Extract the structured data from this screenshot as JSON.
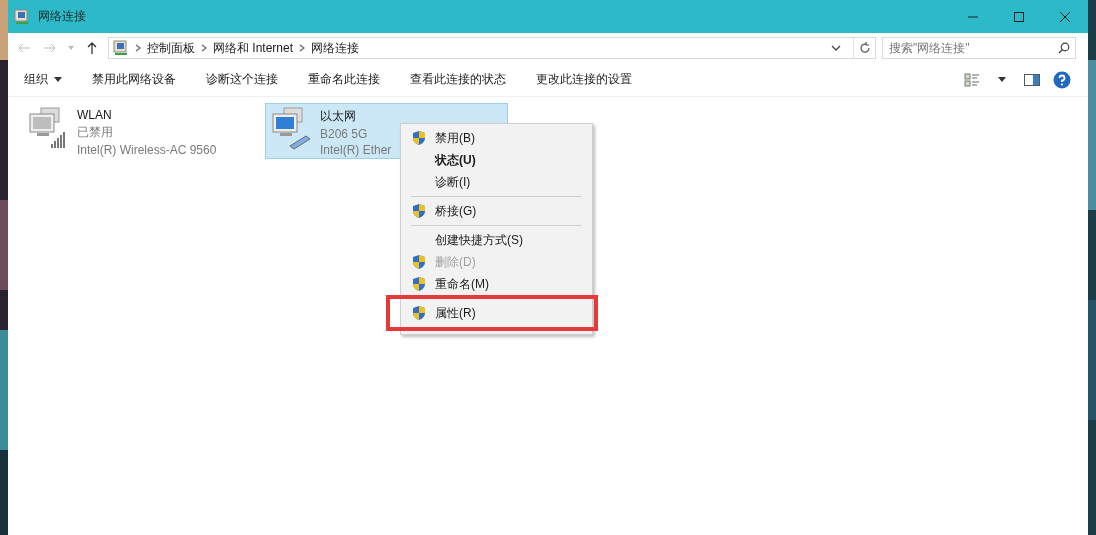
{
  "window": {
    "title": "网络连接"
  },
  "address": {
    "crumbs": [
      "控制面板",
      "网络和 Internet",
      "网络连接"
    ]
  },
  "search": {
    "placeholder": "搜索\"网络连接\""
  },
  "commands": [
    {
      "label": "组织",
      "dropdown": true
    },
    {
      "label": "禁用此网络设备",
      "dropdown": false
    },
    {
      "label": "诊断这个连接",
      "dropdown": false
    },
    {
      "label": "重命名此连接",
      "dropdown": false
    },
    {
      "label": "查看此连接的状态",
      "dropdown": false
    },
    {
      "label": "更改此连接的设置",
      "dropdown": false
    }
  ],
  "connections": [
    {
      "kind": "wifi",
      "name": "WLAN",
      "status": "已禁用",
      "adapter": "Intel(R) Wireless-AC 9560",
      "selected": false
    },
    {
      "kind": "ethernet",
      "name": "以太网",
      "status": "B206 5G",
      "adapter": "Intel(R) Ether",
      "selected": true
    }
  ],
  "context_menu": {
    "items": [
      {
        "kind": "item",
        "label": "禁用(B)",
        "shield": true,
        "bold": false,
        "disabled": false,
        "highlighted": false
      },
      {
        "kind": "item",
        "label": "状态(U)",
        "shield": false,
        "bold": true,
        "disabled": false,
        "highlighted": false
      },
      {
        "kind": "item",
        "label": "诊断(I)",
        "shield": false,
        "bold": false,
        "disabled": false,
        "highlighted": false
      },
      {
        "kind": "separator"
      },
      {
        "kind": "item",
        "label": "桥接(G)",
        "shield": true,
        "bold": false,
        "disabled": false,
        "highlighted": false
      },
      {
        "kind": "separator"
      },
      {
        "kind": "item",
        "label": "创建快捷方式(S)",
        "shield": false,
        "bold": false,
        "disabled": false,
        "highlighted": false
      },
      {
        "kind": "item",
        "label": "删除(D)",
        "shield": true,
        "bold": false,
        "disabled": true,
        "highlighted": false
      },
      {
        "kind": "item",
        "label": "重命名(M)",
        "shield": true,
        "bold": false,
        "disabled": false,
        "highlighted": false
      },
      {
        "kind": "item",
        "label": "属性(R)",
        "shield": true,
        "bold": false,
        "disabled": false,
        "highlighted": true
      }
    ]
  }
}
